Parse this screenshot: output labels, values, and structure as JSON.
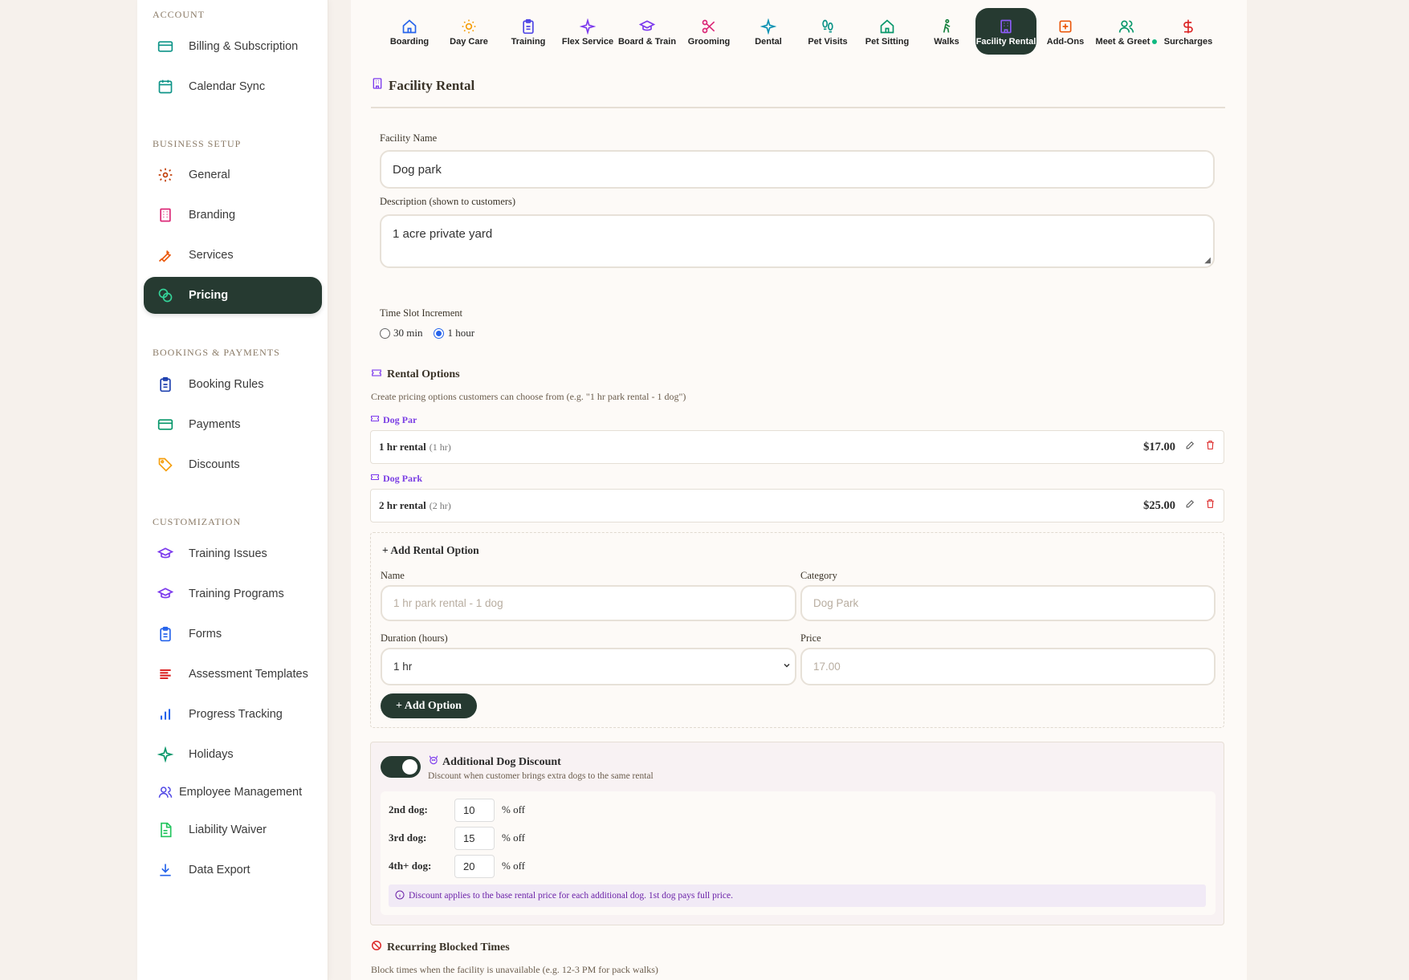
{
  "sidebar": {
    "sections": [
      {
        "title": "ACCOUNT",
        "items": [
          {
            "label": "Billing & Subscription",
            "icon": "credit-card-icon"
          },
          {
            "label": "Calendar Sync",
            "icon": "calendar-icon"
          }
        ]
      },
      {
        "title": "BUSINESS SETUP",
        "items": [
          {
            "label": "General",
            "icon": "gear-icon"
          },
          {
            "label": "Branding",
            "icon": "building-icon"
          },
          {
            "label": "Services",
            "icon": "wrench-icon"
          },
          {
            "label": "Pricing",
            "icon": "coins-icon",
            "active": true
          }
        ]
      },
      {
        "title": "BOOKINGS & PAYMENTS",
        "items": [
          {
            "label": "Booking Rules",
            "icon": "clipboard-icon"
          },
          {
            "label": "Payments",
            "icon": "credit-card-icon"
          },
          {
            "label": "Discounts",
            "icon": "tag-icon"
          }
        ]
      },
      {
        "title": "CUSTOMIZATION",
        "items": [
          {
            "label": "Training Issues",
            "icon": "graduation-cap-icon"
          },
          {
            "label": "Training Programs",
            "icon": "graduation-cap-icon"
          },
          {
            "label": "Forms",
            "icon": "clipboard-icon"
          },
          {
            "label": "Assessment Templates",
            "icon": "list-icon"
          },
          {
            "label": "Progress Tracking",
            "icon": "bar-chart-icon"
          },
          {
            "label": "Holidays",
            "icon": "sparkle-icon"
          },
          {
            "label": "Employee Management",
            "icon": "users-icon"
          },
          {
            "label": "Liability Waiver",
            "icon": "document-icon"
          },
          {
            "label": "Data Export",
            "icon": "download-icon"
          }
        ]
      }
    ]
  },
  "tabs": [
    {
      "label": "Boarding",
      "icon": "house-icon",
      "color": "#2563eb"
    },
    {
      "label": "Day Care",
      "icon": "sun-icon",
      "color": "#f59e0b"
    },
    {
      "label": "Training",
      "icon": "clipboard-icon",
      "color": "#4f46e5"
    },
    {
      "label": "Flex Service",
      "icon": "sparkle-icon",
      "color": "#7c3aed"
    },
    {
      "label": "Board & Train",
      "icon": "graduation-cap-icon",
      "color": "#7c3aed"
    },
    {
      "label": "Grooming",
      "icon": "scissors-icon",
      "color": "#db2777"
    },
    {
      "label": "Dental",
      "icon": "sparkle-icon",
      "color": "#0891b2"
    },
    {
      "label": "Pet Visits",
      "icon": "footprints-icon",
      "color": "#0d9488"
    },
    {
      "label": "Pet Sitting",
      "icon": "house-icon",
      "color": "#059669"
    },
    {
      "label": "Walks",
      "icon": "walking-icon",
      "color": "#15803d"
    },
    {
      "label": "Facility Rental",
      "icon": "building-icon",
      "color": "#7c3aed",
      "active": true
    },
    {
      "label": "Add-Ons",
      "icon": "plus-square-icon",
      "color": "#ea580c"
    },
    {
      "label": "Meet & Greet",
      "icon": "users-icon",
      "color": "#059669"
    },
    {
      "label": "Surcharges",
      "icon": "dollar-icon",
      "color": "#dc2626"
    }
  ],
  "facility": {
    "heading": "Facility Rental",
    "name_label": "Facility Name",
    "name_value": "Dog park",
    "desc_label": "Description (shown to customers)",
    "desc_value": "1 acre private yard",
    "slot_label": "Time Slot Increment",
    "slot_options": [
      "30 min",
      "1 hour"
    ],
    "slot_selected": "1 hour"
  },
  "rental_options": {
    "heading": "Rental Options",
    "help": "Create pricing options customers can choose from (e.g. \"1 hr park rental - 1 dog\")",
    "items": [
      {
        "category": "Dog Par",
        "name": "1 hr rental",
        "duration": "(1 hr)",
        "price": "$17.00"
      },
      {
        "category": "Dog Park",
        "name": "2 hr rental",
        "duration": "(2 hr)",
        "price": "$25.00"
      }
    ]
  },
  "add_option": {
    "heading": "+ Add Rental Option",
    "name_label": "Name",
    "name_placeholder": "1 hr park rental - 1 dog",
    "category_label": "Category",
    "category_placeholder": "Dog Park",
    "duration_label": "Duration (hours)",
    "duration_value": "1 hr",
    "price_label": "Price",
    "price_placeholder": "17.00",
    "button": "+ Add Option"
  },
  "discount": {
    "heading": "Additional Dog Discount",
    "subtitle": "Discount when customer brings extra dogs to the same rental",
    "enabled": true,
    "rows": [
      {
        "label": "2nd dog:",
        "value": "10",
        "suffix": "% off"
      },
      {
        "label": "3rd dog:",
        "value": "15",
        "suffix": "% off"
      },
      {
        "label": "4th+ dog:",
        "value": "20",
        "suffix": "% off"
      }
    ],
    "note": "Discount applies to the base rental price for each additional dog. 1st dog pays full price."
  },
  "blocked": {
    "heading": "Recurring Blocked Times",
    "help": "Block times when the facility is unavailable (e.g. 12-3 PM for pack walks)"
  }
}
